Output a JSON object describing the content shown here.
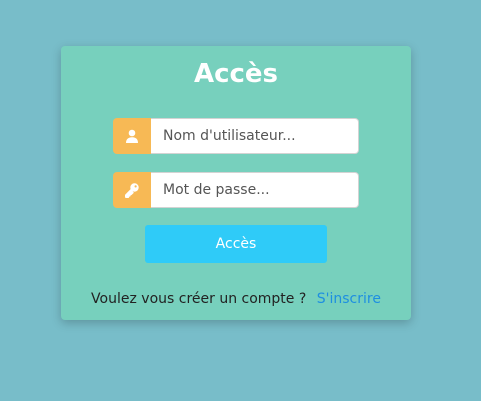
{
  "page": {
    "background_color": "#78bdc9"
  },
  "login_card": {
    "title": "Accès",
    "background_color": "#77d0bd",
    "username": {
      "icon": "user-icon",
      "placeholder": "Nom d'utilisateur...",
      "value": ""
    },
    "password": {
      "icon": "key-icon",
      "placeholder": "Mot de passe...",
      "value": ""
    },
    "submit_label": "Accès",
    "submit_color": "#2fcbf8",
    "icon_addon_color": "#f7b955",
    "signup_prompt": "Voulez vous créer un compte ?",
    "signup_link": "S'inscrire",
    "signup_link_color": "#1e8fe0"
  }
}
